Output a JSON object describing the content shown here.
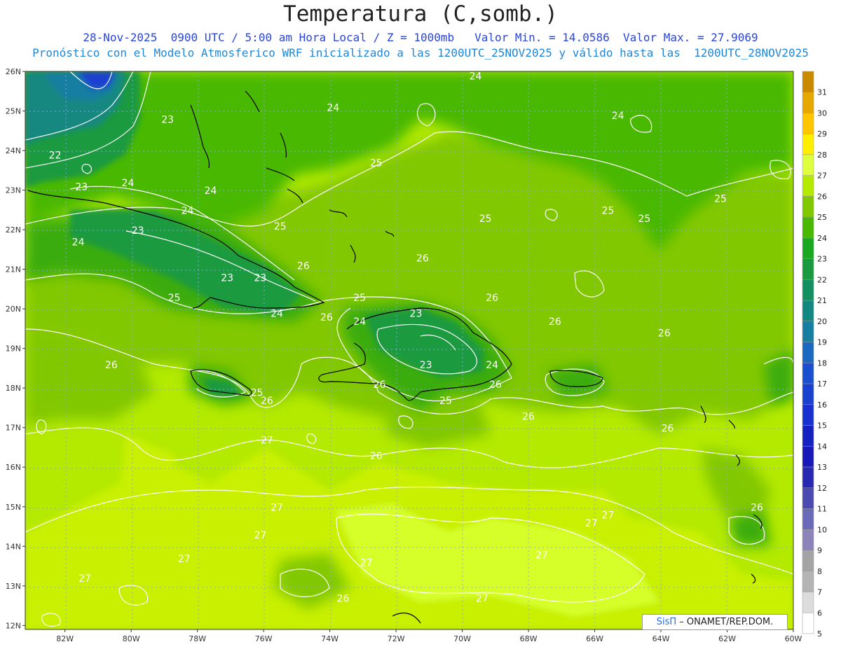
{
  "header": {
    "title": "Temperatura (C,somb.)",
    "subtitle_line1": "28-Nov-2025  0900 UTC / 5:00 am Hora Local / Z = 1000mb   Valor Min. = 14.0586  Valor Max. = 27.9069",
    "subtitle_line2": "Pronóstico con el Modelo Atmosferico WRF inicializado a las 1200UTC_25NOV2025 y válido hasta las  1200UTC_28NOV2025"
  },
  "map": {
    "lat_labels": [
      "26N",
      "25N",
      "24N",
      "23N",
      "22N",
      "21N",
      "20N",
      "19N",
      "18N",
      "17N",
      "16N",
      "15N",
      "14N",
      "13N",
      "12N"
    ],
    "lat_values": [
      26,
      25,
      24,
      23,
      22,
      21,
      20,
      19,
      18,
      17,
      16,
      15,
      14,
      13,
      12
    ],
    "lon_labels": [
      "82W",
      "80W",
      "78W",
      "76W",
      "74W",
      "72W",
      "70W",
      "68W",
      "66W",
      "64W",
      "62W",
      "60W"
    ],
    "lon_values": [
      -82,
      -80,
      -78,
      -76,
      -74,
      -72,
      -70,
      -68,
      -66,
      -64,
      -62,
      -60
    ],
    "extent": {
      "west": -83.2,
      "east": -60.0,
      "south": 11.9,
      "north": 26.0
    },
    "contour_labels": [
      {
        "text": "24",
        "lon": -69.6,
        "lat": 25.8
      },
      {
        "text": "24",
        "lon": -73.9,
        "lat": 25.0
      },
      {
        "text": "24",
        "lon": -65.3,
        "lat": 24.8
      },
      {
        "text": "23",
        "lon": -78.9,
        "lat": 24.7
      },
      {
        "text": "22",
        "lon": -82.3,
        "lat": 23.8
      },
      {
        "text": "25",
        "lon": -72.6,
        "lat": 23.6
      },
      {
        "text": "23",
        "lon": -81.5,
        "lat": 23.0
      },
      {
        "text": "24",
        "lon": -80.1,
        "lat": 23.1
      },
      {
        "text": "24",
        "lon": -77.6,
        "lat": 22.9
      },
      {
        "text": "25",
        "lon": -62.2,
        "lat": 22.7
      },
      {
        "text": "24",
        "lon": -78.3,
        "lat": 22.4
      },
      {
        "text": "25",
        "lon": -65.6,
        "lat": 22.4
      },
      {
        "text": "25",
        "lon": -64.5,
        "lat": 22.2
      },
      {
        "text": "25",
        "lon": -69.3,
        "lat": 22.2
      },
      {
        "text": "23",
        "lon": -79.8,
        "lat": 21.9
      },
      {
        "text": "25",
        "lon": -75.5,
        "lat": 22.0
      },
      {
        "text": "24",
        "lon": -81.6,
        "lat": 21.6
      },
      {
        "text": "26",
        "lon": -71.2,
        "lat": 21.2
      },
      {
        "text": "26",
        "lon": -74.8,
        "lat": 21.0
      },
      {
        "text": "23",
        "lon": -77.1,
        "lat": 20.7
      },
      {
        "text": "23",
        "lon": -76.1,
        "lat": 20.7
      },
      {
        "text": "25",
        "lon": -78.7,
        "lat": 20.2
      },
      {
        "text": "25",
        "lon": -73.1,
        "lat": 20.2
      },
      {
        "text": "26",
        "lon": -69.1,
        "lat": 20.2
      },
      {
        "text": "24",
        "lon": -75.6,
        "lat": 19.8
      },
      {
        "text": "23",
        "lon": -71.4,
        "lat": 19.8
      },
      {
        "text": "26",
        "lon": -74.1,
        "lat": 19.7
      },
      {
        "text": "24",
        "lon": -73.1,
        "lat": 19.6
      },
      {
        "text": "26",
        "lon": -67.2,
        "lat": 19.6
      },
      {
        "text": "26",
        "lon": -63.9,
        "lat": 19.3
      },
      {
        "text": "26",
        "lon": -80.6,
        "lat": 18.5
      },
      {
        "text": "23",
        "lon": -71.1,
        "lat": 18.5
      },
      {
        "text": "24",
        "lon": -69.1,
        "lat": 18.5
      },
      {
        "text": "26",
        "lon": -72.5,
        "lat": 18.0
      },
      {
        "text": "26",
        "lon": -69.0,
        "lat": 18.0
      },
      {
        "text": "25",
        "lon": -76.2,
        "lat": 17.8
      },
      {
        "text": "25",
        "lon": -70.5,
        "lat": 17.6
      },
      {
        "text": "26",
        "lon": -75.9,
        "lat": 17.6
      },
      {
        "text": "26",
        "lon": -68.0,
        "lat": 17.2
      },
      {
        "text": "26",
        "lon": -63.8,
        "lat": 16.9
      },
      {
        "text": "27",
        "lon": -75.9,
        "lat": 16.6
      },
      {
        "text": "26",
        "lon": -72.6,
        "lat": 16.2
      },
      {
        "text": "26",
        "lon": -61.1,
        "lat": 14.9
      },
      {
        "text": "27",
        "lon": -75.6,
        "lat": 14.9
      },
      {
        "text": "27",
        "lon": -65.6,
        "lat": 14.7
      },
      {
        "text": "27",
        "lon": -66.1,
        "lat": 14.5
      },
      {
        "text": "27",
        "lon": -76.1,
        "lat": 14.2
      },
      {
        "text": "27",
        "lon": -67.6,
        "lat": 13.7
      },
      {
        "text": "27",
        "lon": -78.4,
        "lat": 13.6
      },
      {
        "text": "27",
        "lon": -72.9,
        "lat": 13.5
      },
      {
        "text": "27",
        "lon": -81.4,
        "lat": 13.1
      },
      {
        "text": "26",
        "lon": -73.6,
        "lat": 12.6
      },
      {
        "text": "27",
        "lon": -69.4,
        "lat": 12.6
      }
    ]
  },
  "colorbar": {
    "labels": [
      "31",
      "30",
      "29",
      "28",
      "27",
      "26",
      "25",
      "24",
      "23",
      "22",
      "21",
      "20",
      "19",
      "18",
      "17",
      "16",
      "15",
      "14",
      "13",
      "12",
      "11",
      "10",
      "9",
      "8",
      "7",
      "6",
      "5"
    ],
    "colors": [
      "#c98a00",
      "#e6a800",
      "#ffc600",
      "#ffee00",
      "#ddff3d",
      "#b4ea00",
      "#82c800",
      "#4ab800",
      "#1aa820",
      "#1a9a40",
      "#149060",
      "#138880",
      "#167ea0",
      "#1a68c0",
      "#1a50d0",
      "#1a40d0",
      "#1830d0",
      "#1420c0",
      "#1818b8",
      "#2828b0",
      "#4a4ab0",
      "#6a6ab8",
      "#8c84b8",
      "#a4a4a4",
      "#b4b4b4",
      "#dcdcdc",
      "#ffffff"
    ]
  },
  "credit": {
    "brand": "SisΠ",
    "text": "– ONAMET/REP.DOM."
  }
}
